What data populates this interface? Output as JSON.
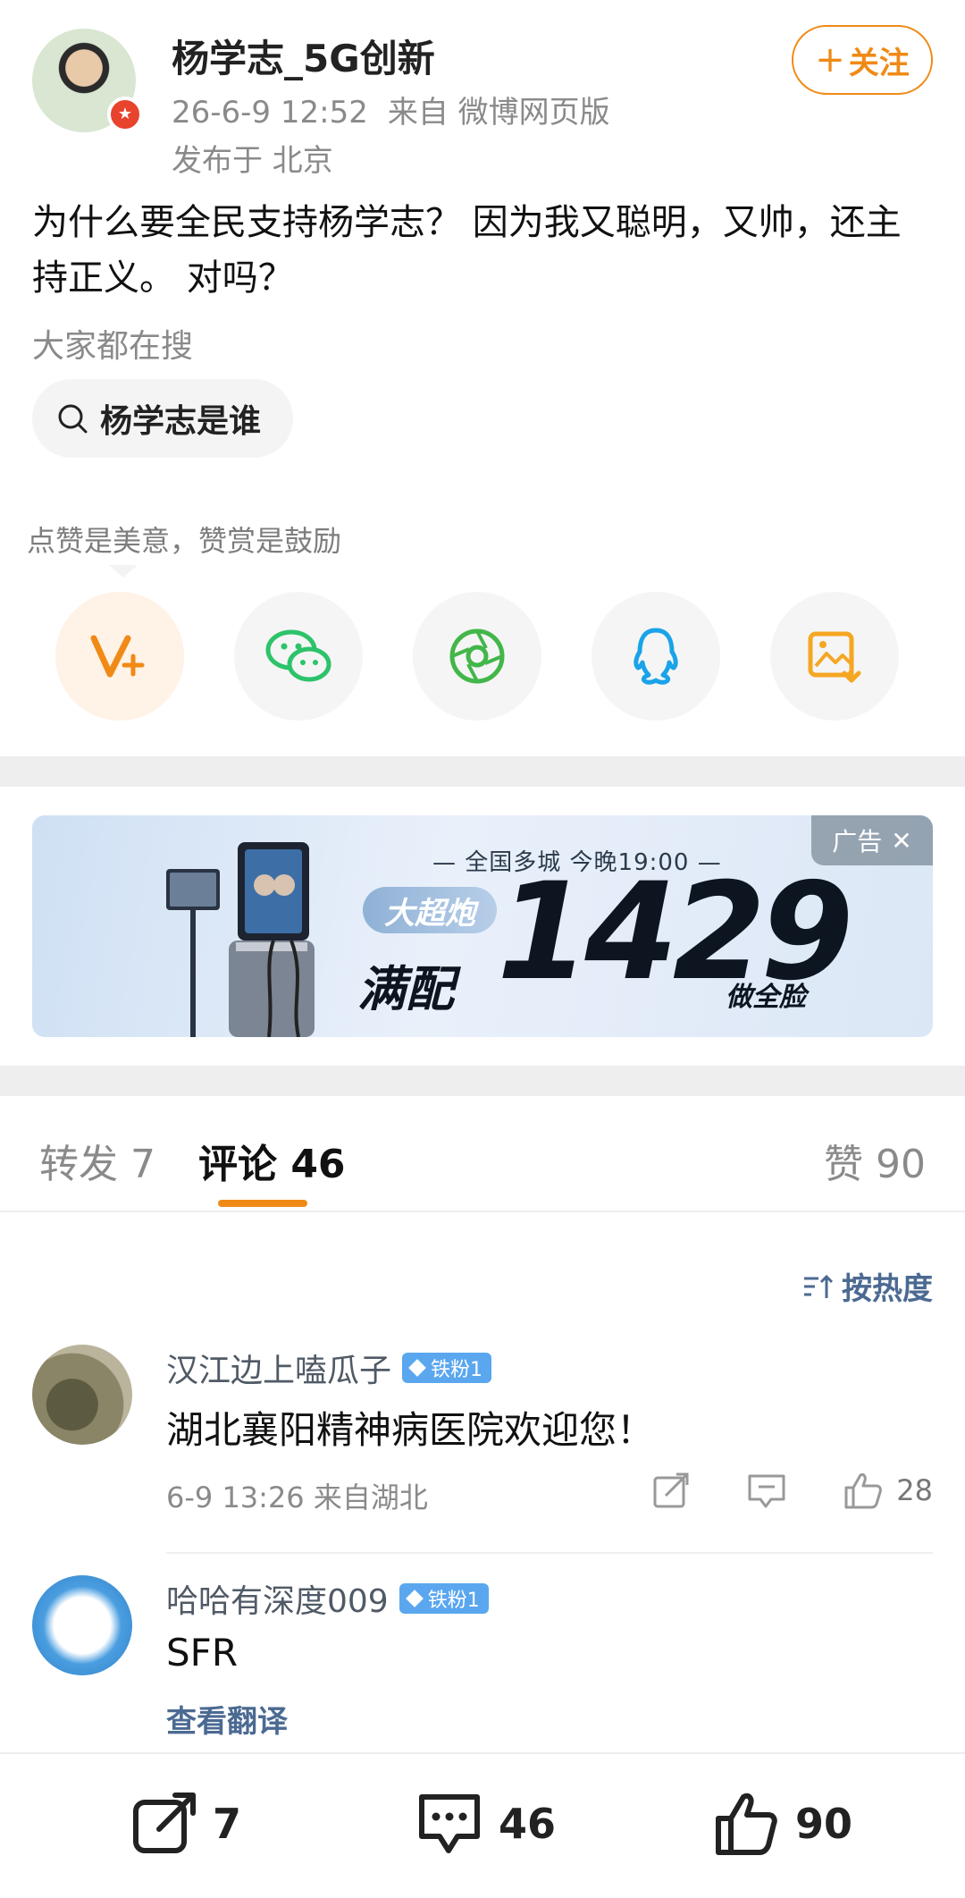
{
  "post": {
    "author": "杨学志_5G创新",
    "time": "26-6-9 12:52",
    "source": "来自 微博网页版",
    "location": "发布于 北京",
    "follow_label": "关注",
    "text": "为什么要全民支持杨学志？ 因为我又聪明，又帅，还主持正义。 对吗？"
  },
  "hot_search": {
    "label": "大家都在搜",
    "chip": "杨学志是谁"
  },
  "reward": {
    "text": "点赞是美意，赞赏是鼓励",
    "share_icons": [
      "vplus-reward-icon",
      "wechat-icon",
      "moments-icon",
      "qq-icon",
      "save-image-icon"
    ]
  },
  "ad": {
    "tag": "广告",
    "line1": "— 全国多城 今晚19:00 —",
    "pill": "大超炮",
    "man": "满配",
    "big": "1429",
    "small": "做全脸"
  },
  "tabs": {
    "repost": "转发 7",
    "comment": "评论 46",
    "like": "赞 90"
  },
  "sort_label": "按热度",
  "comments": [
    {
      "name": "汉江边上嗑瓜子",
      "badge": "铁粉1",
      "text": "湖北襄阳精神病医院欢迎您！",
      "meta": "6-9 13:26  来自湖北",
      "likes": "28"
    },
    {
      "name": "哈哈有深度009",
      "badge": "铁粉1",
      "text": "SFR",
      "translate": "查看翻译"
    }
  ],
  "bottom": {
    "repost": "7",
    "comment": "46",
    "like": "90"
  },
  "colors": {
    "accent": "#f08a17",
    "link": "#4b6a92",
    "badge": "#5aa7ef"
  }
}
